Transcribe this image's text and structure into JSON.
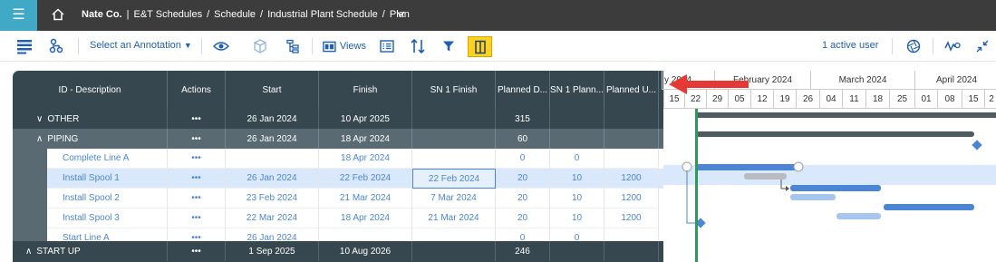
{
  "topbar": {
    "menu_icon": "hamburger-icon",
    "home_icon": "home-icon",
    "company": "Nate Co.",
    "crumbs": [
      "E&T Schedules",
      "Schedule",
      "Industrial Plant Schedule",
      "Plan"
    ],
    "separator_first": "|",
    "separator": "/"
  },
  "toolbar": {
    "annotation_label": "Select an Annotation",
    "views_label": "Views",
    "active_users": "1 active user",
    "highlight_color": "#ffd21f",
    "accent_color": "#1f5fb3"
  },
  "grid": {
    "headers": [
      "ID - Description",
      "Actions",
      "Start",
      "Finish",
      "SN 1 Finish",
      "Planned D...",
      "SN 1 Plann...",
      "Planned U..."
    ],
    "rows": [
      {
        "type": "group",
        "toggle": "∨",
        "description": "OTHER",
        "actions": "•••",
        "start": "26 Jan 2024",
        "finish": "10 Apr 2025",
        "sn1_finish": "",
        "planned_d": "315",
        "sn1_planned": "",
        "planned_u": ""
      },
      {
        "type": "group",
        "toggle": "∧",
        "description": "PIPING",
        "actions": "•••",
        "start": "26 Jan 2024",
        "finish": "18 Apr 2024",
        "sn1_finish": "",
        "planned_d": "60",
        "sn1_planned": "",
        "planned_u": ""
      },
      {
        "type": "task",
        "description": "Complete Line A",
        "actions": "•••",
        "start": "",
        "finish": "18 Apr 2024",
        "sn1_finish": "",
        "planned_d": "0",
        "sn1_planned": "0",
        "planned_u": ""
      },
      {
        "type": "task",
        "selected": true,
        "description": "Install Spool 1",
        "actions": "•••",
        "start": "26 Jan 2024",
        "finish": "22 Feb 2024",
        "sn1_finish": "22 Feb 2024",
        "planned_d": "20",
        "sn1_planned": "10",
        "planned_u": "1200"
      },
      {
        "type": "task",
        "description": "Install Spool 2",
        "actions": "•••",
        "start": "23 Feb 2024",
        "finish": "21 Mar 2024",
        "sn1_finish": "7 Mar 2024",
        "planned_d": "20",
        "sn1_planned": "10",
        "planned_u": "1200"
      },
      {
        "type": "task",
        "description": "Install Spool 3",
        "actions": "•••",
        "start": "22 Mar 2024",
        "finish": "18 Apr 2024",
        "sn1_finish": "21 Mar 2024",
        "planned_d": "20",
        "sn1_planned": "10",
        "planned_u": "1200"
      },
      {
        "type": "task",
        "description": "Start Line A",
        "actions": "•••",
        "start": "26 Jan 2024",
        "finish": "",
        "sn1_finish": "",
        "planned_d": "0",
        "sn1_planned": "0",
        "planned_u": ""
      },
      {
        "type": "group",
        "toggle": "∧",
        "description": "START UP",
        "actions": "•••",
        "start": "1 Sep 2025",
        "finish": "10 Aug 2026",
        "sn1_finish": "",
        "planned_d": "246",
        "sn1_planned": "",
        "planned_u": ""
      }
    ]
  },
  "timeline": {
    "months": [
      "y 2024",
      "February 2024",
      "March 2024",
      "April 2024"
    ],
    "weeks": [
      "15",
      "22",
      "29",
      "05",
      "12",
      "19",
      "26",
      "04",
      "11",
      "18",
      "25",
      "01",
      "08",
      "15",
      "2"
    ],
    "colors": {
      "summary": "#4f5b63",
      "bar": "#4a86d4",
      "baseline_light": "#a7c6ee",
      "baseline_gray": "#b8bcc0",
      "today": "#2c9b5a",
      "callout": "#e53935"
    }
  }
}
